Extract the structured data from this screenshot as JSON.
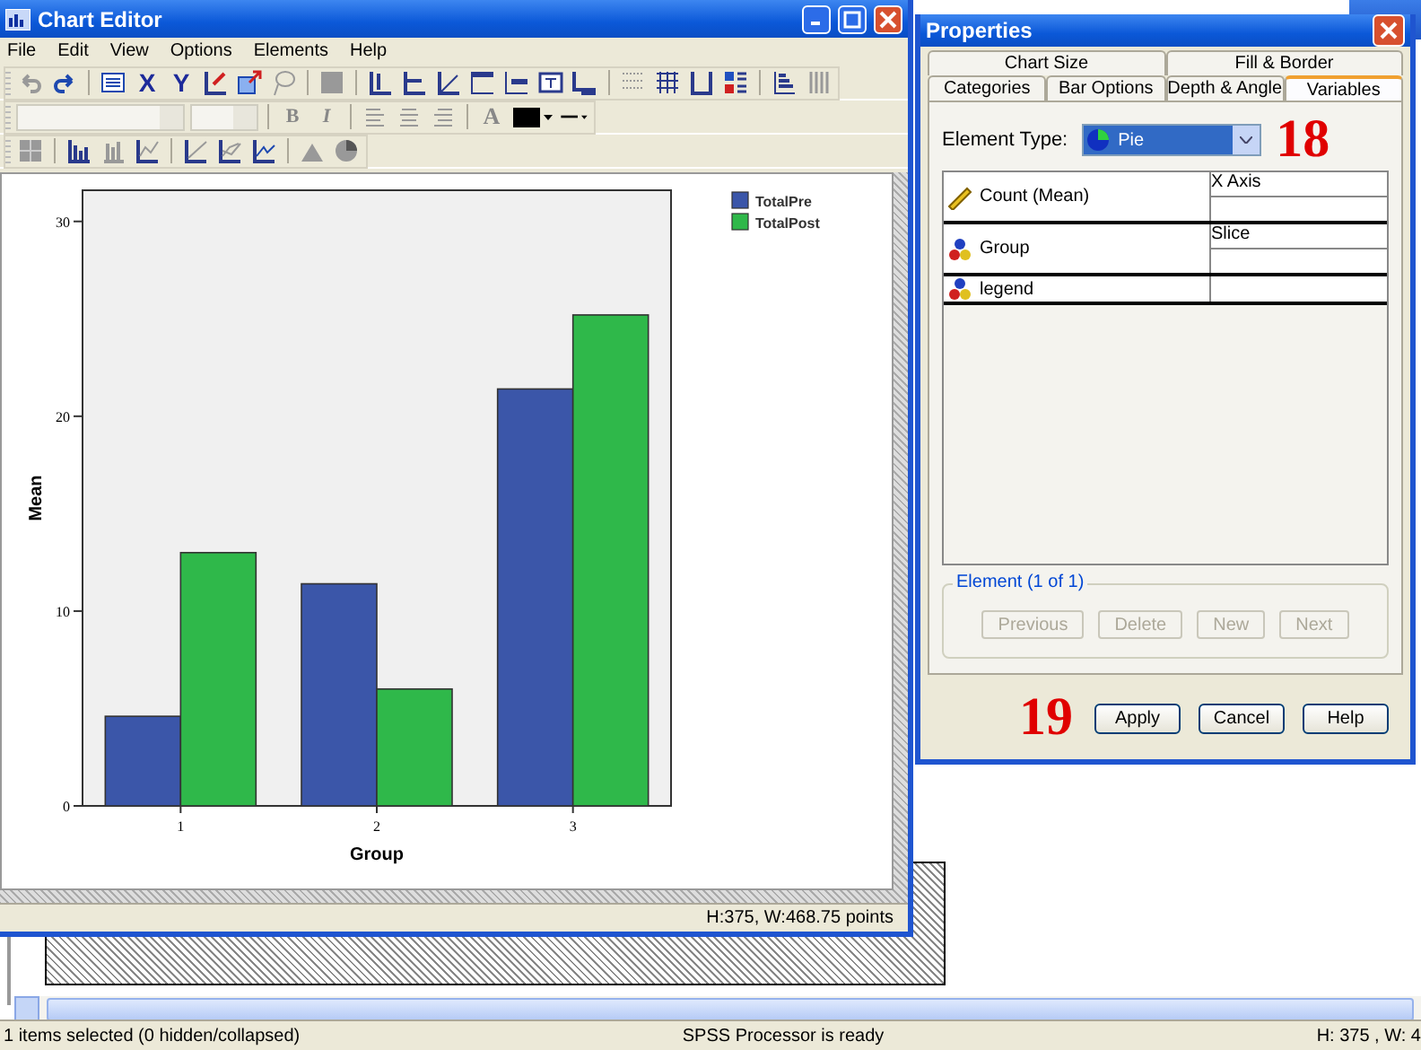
{
  "chart_editor": {
    "title": "Chart Editor",
    "menu": [
      "File",
      "Edit",
      "View",
      "Options",
      "Elements",
      "Help"
    ],
    "toolbar_glyphs": [
      "X",
      "Y",
      "B",
      "I",
      "A"
    ],
    "chart_data": {
      "type": "bar",
      "xlabel": "Group",
      "ylabel": "Mean",
      "categories": [
        "1",
        "2",
        "3"
      ],
      "series": [
        {
          "name": "TotalPre",
          "color": "#3b56a9",
          "values": [
            4.6,
            11.4,
            21.4
          ]
        },
        {
          "name": "TotalPost",
          "color": "#2fb84a",
          "values": [
            13,
            6,
            25.2
          ]
        }
      ],
      "ylim": [
        0,
        31.6
      ],
      "yticks": [
        0,
        10,
        20,
        30
      ],
      "legend": true
    },
    "status": "H:375, W:468.75 points"
  },
  "properties": {
    "title": "Properties",
    "tab_rows": [
      [
        {
          "label": "Chart Size",
          "selected": false
        },
        {
          "label": "Fill & Border",
          "selected": false
        }
      ],
      [
        {
          "label": "Categories",
          "selected": false
        },
        {
          "label": "Bar Options",
          "selected": false
        },
        {
          "label": "Depth & Angle",
          "selected": false
        },
        {
          "label": "Variables",
          "selected": true
        }
      ]
    ],
    "element_type": {
      "label": "Element Type:",
      "value": "Pie"
    },
    "variables": [
      {
        "name": "Count (Mean)",
        "kind": "scale",
        "role": "X Axis"
      },
      {
        "name": "Group",
        "kind": "nominal",
        "role": "Slice"
      },
      {
        "name": "legend",
        "kind": "nominal"
      }
    ],
    "element_group": {
      "title": "Element (1 of 1)",
      "buttons": [
        {
          "label": "Previous",
          "disabled": true
        },
        {
          "label": "Delete",
          "disabled": true
        },
        {
          "label": "New",
          "disabled": true
        },
        {
          "label": "Next",
          "disabled": true
        }
      ]
    },
    "buttons": [
      "Apply",
      "Cancel",
      "Help"
    ]
  },
  "annotations": [
    "18",
    "19"
  ],
  "status_bar": {
    "selection": "1 items selected (0 hidden/collapsed)",
    "processor": "SPSS Processor is ready",
    "size": "H: 375 , W: 4"
  }
}
